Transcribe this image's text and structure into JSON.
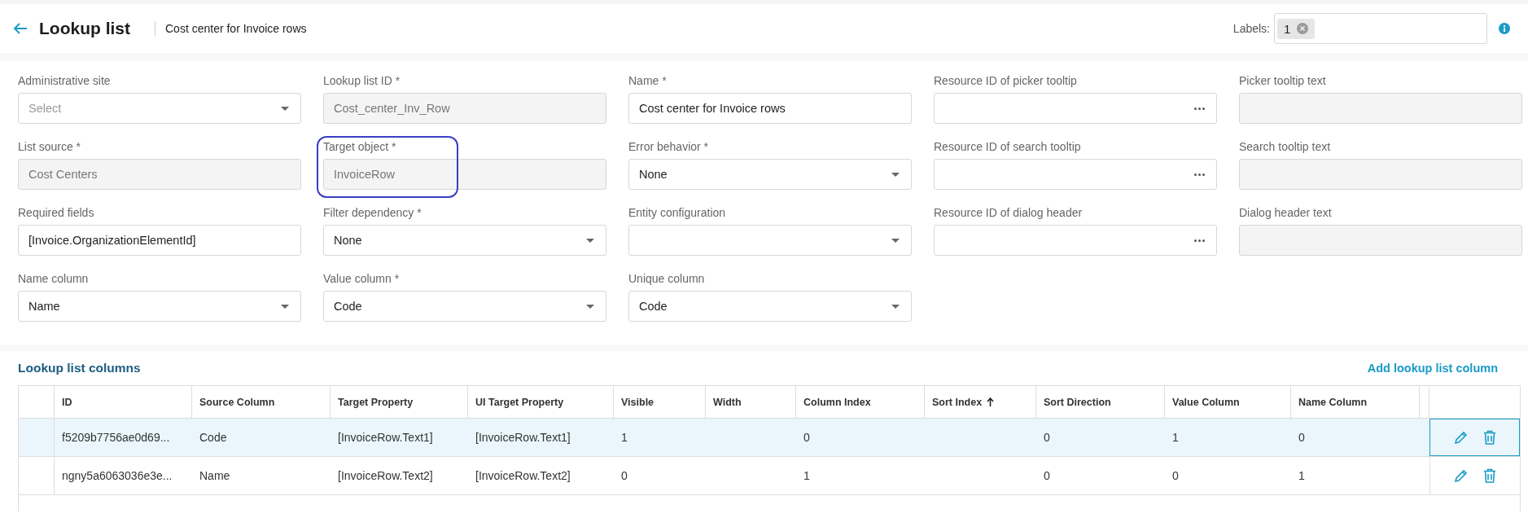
{
  "header": {
    "title": "Lookup list",
    "subtitle": "Cost center for Invoice rows",
    "labels_label": "Labels:",
    "labels": [
      {
        "text": "1"
      }
    ]
  },
  "fields": [
    {
      "label": "Administrative site",
      "kind": "select",
      "placeholder": "Select"
    },
    {
      "label": "Lookup list ID *",
      "kind": "disabled",
      "value": "Cost_center_Inv_Row"
    },
    {
      "label": "Name *",
      "kind": "text",
      "value": "Cost center for Invoice rows"
    },
    {
      "label": "Resource ID of picker tooltip",
      "kind": "lookup"
    },
    {
      "label": "Picker tooltip text",
      "kind": "disabled"
    },
    {
      "label": "List source *",
      "kind": "disabled",
      "value": "Cost Centers"
    },
    {
      "label": "Target object *",
      "kind": "disabled",
      "value": "InvoiceRow",
      "highlighted": true
    },
    {
      "label": "Error behavior *",
      "kind": "select",
      "value": "None"
    },
    {
      "label": "Resource ID of search tooltip",
      "kind": "lookup"
    },
    {
      "label": "Search tooltip text",
      "kind": "disabled"
    },
    {
      "label": "Required fields",
      "kind": "text",
      "value": "[Invoice.OrganizationElementId]"
    },
    {
      "label": "Filter dependency *",
      "kind": "select",
      "value": "None"
    },
    {
      "label": "Entity configuration",
      "kind": "select"
    },
    {
      "label": "Resource ID of dialog header",
      "kind": "lookup"
    },
    {
      "label": "Dialog header text",
      "kind": "disabled"
    },
    {
      "label": "Name column",
      "kind": "select",
      "value": "Name"
    },
    {
      "label": "Value column *",
      "kind": "select",
      "value": "Code"
    },
    {
      "label": "Unique column",
      "kind": "select",
      "value": "Code"
    }
  ],
  "table": {
    "title": "Lookup list columns",
    "add_link": "Add lookup list column",
    "columns": [
      {
        "label": "ID",
        "sorted": false
      },
      {
        "label": "Source Column",
        "sorted": false
      },
      {
        "label": "Target Property",
        "sorted": false
      },
      {
        "label": "UI Target Property",
        "sorted": false
      },
      {
        "label": "Visible",
        "sorted": false
      },
      {
        "label": "Width",
        "sorted": false
      },
      {
        "label": "Column Index",
        "sorted": false
      },
      {
        "label": "Sort Index",
        "sorted": true
      },
      {
        "label": "Sort Direction",
        "sorted": false
      },
      {
        "label": "Value Column",
        "sorted": false
      },
      {
        "label": "Name Column",
        "sorted": false
      }
    ],
    "rows": [
      {
        "selected": true,
        "cells": [
          "f5209b7756ae0d69...",
          "Code",
          "[InvoiceRow.Text1]",
          "[InvoiceRow.Text1]",
          "1",
          "",
          "0",
          "",
          "0",
          "1",
          "0"
        ]
      },
      {
        "selected": false,
        "cells": [
          "ngny5a6063036e3e...",
          "Name",
          "[InvoiceRow.Text2]",
          "[InvoiceRow.Text2]",
          "0",
          "",
          "1",
          "",
          "0",
          "0",
          "1"
        ]
      }
    ]
  }
}
